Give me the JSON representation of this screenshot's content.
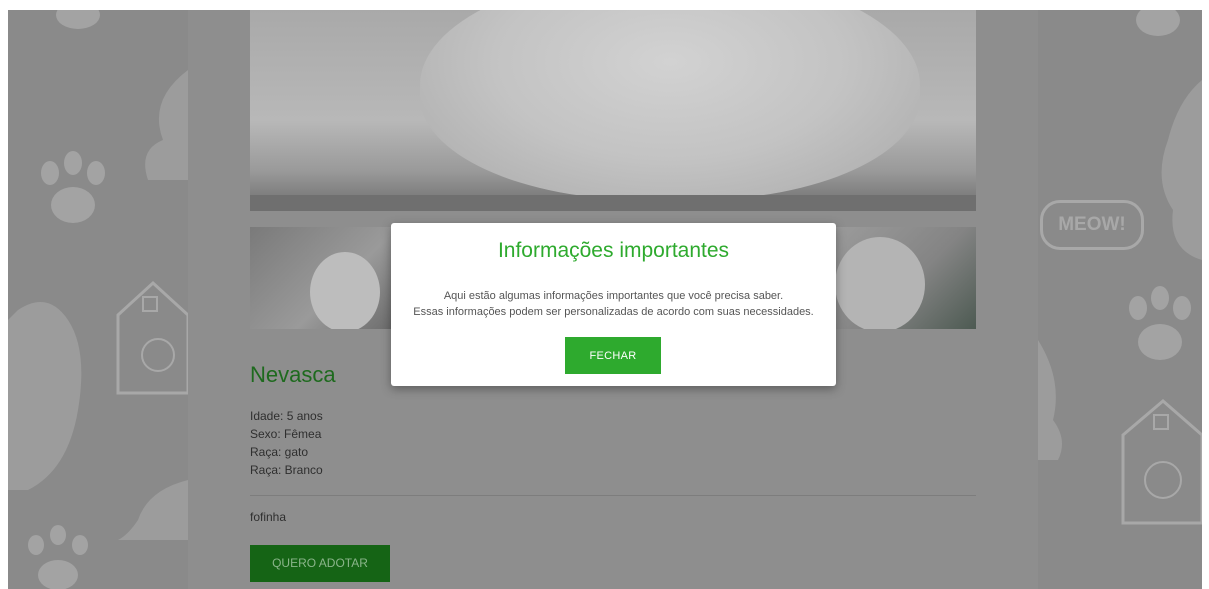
{
  "pet": {
    "name": "Nevasca",
    "details": [
      "Idade: 5 anos",
      "Sexo: Fêmea",
      "Raça: gato",
      "Raça: Branco"
    ],
    "description": "fofinha",
    "adopt_label": "QUERO ADOTAR"
  },
  "decor": {
    "meow_text": "MEOW!"
  },
  "modal": {
    "title": "Informações importantes",
    "lines": [
      "Aqui estão algumas informações importantes que você precisa saber.",
      "Essas informações podem ser personalizadas de acordo com suas necessidades."
    ],
    "close_label": "FECHAR"
  },
  "colors": {
    "accent_green": "#2eaa2e",
    "dark_green": "#156415",
    "overlay_gray": "#878787"
  }
}
